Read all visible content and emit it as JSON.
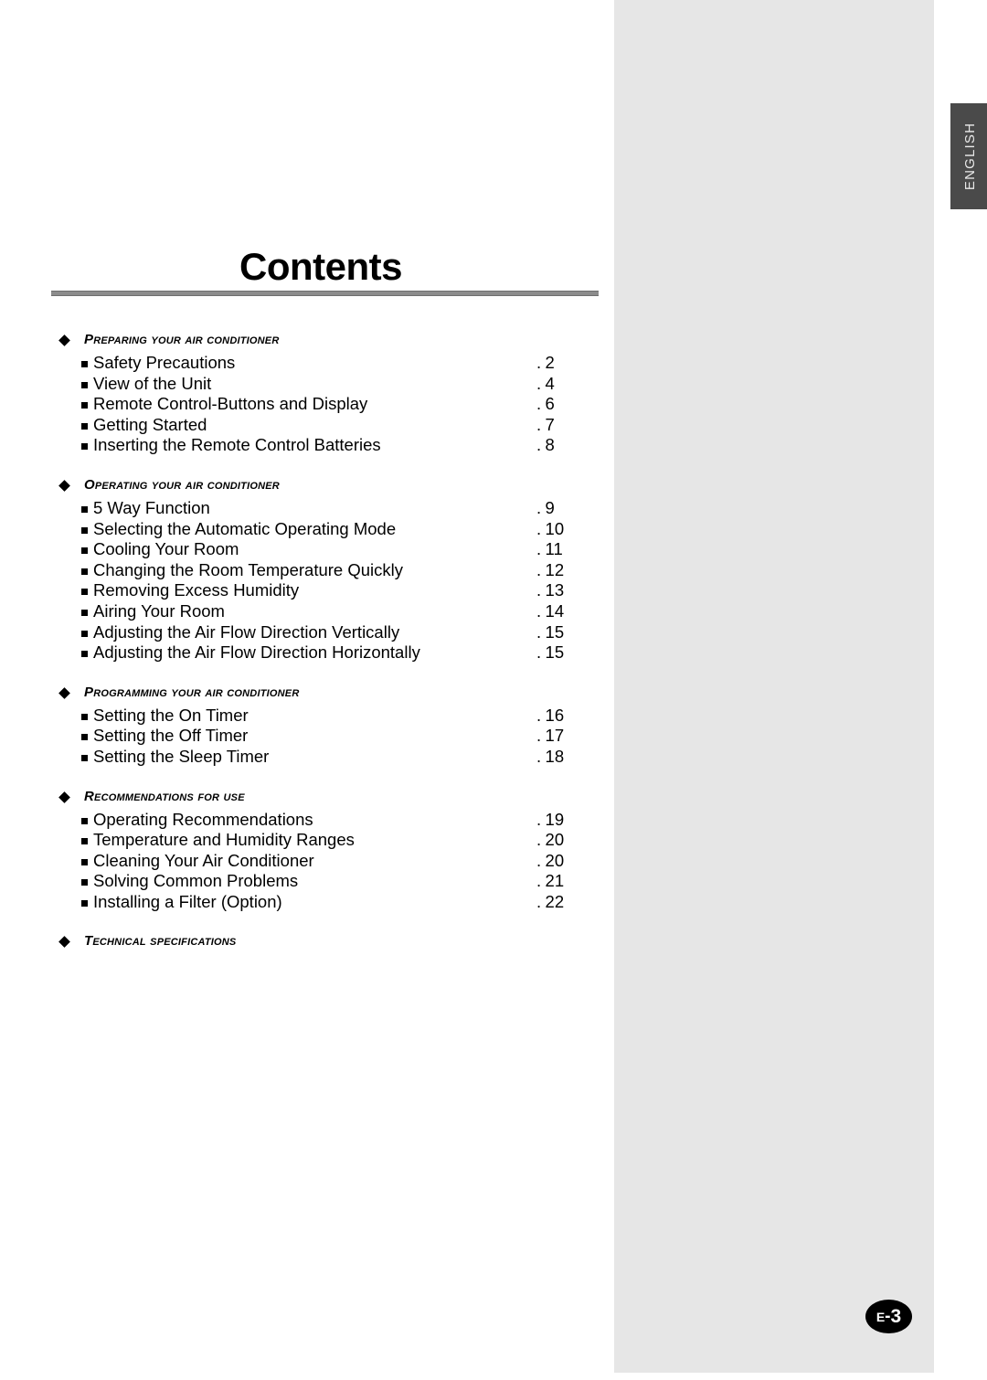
{
  "document": {
    "title": "Contents",
    "page_badge": {
      "prefix": "E",
      "separator": "-",
      "number": "3"
    },
    "language_tab": "ENGLISH"
  },
  "icons": {
    "diamond": "diamond-bullet-icon",
    "square": "square-bullet-icon"
  },
  "toc": {
    "sections": [
      {
        "heading": "Preparing your air conditioner",
        "entries": [
          {
            "title": "Safety Precautions",
            "page": "2"
          },
          {
            "title": "View of the Unit",
            "page": "4"
          },
          {
            "title": "Remote Control-Buttons and Display",
            "page": "6"
          },
          {
            "title": "Getting Started",
            "page": "7"
          },
          {
            "title": "Inserting the Remote Control Batteries",
            "page": "8"
          }
        ]
      },
      {
        "heading": "Operating your air conditioner",
        "entries": [
          {
            "title": "5 Way Function",
            "page": "9"
          },
          {
            "title": "Selecting the Automatic Operating Mode",
            "page": "10"
          },
          {
            "title": "Cooling Your Room",
            "page": "11"
          },
          {
            "title": "Changing the Room Temperature Quickly",
            "page": "12"
          },
          {
            "title": "Removing Excess Humidity",
            "page": "13"
          },
          {
            "title": "Airing Your Room",
            "page": "14"
          },
          {
            "title": "Adjusting the Air Flow Direction Vertically",
            "page": "15"
          },
          {
            "title": "Adjusting the Air Flow Direction Horizontally",
            "page": "15"
          }
        ]
      },
      {
        "heading": "Programming your air conditioner",
        "entries": [
          {
            "title": "Setting the On Timer",
            "page": "16"
          },
          {
            "title": "Setting the Off Timer",
            "page": "17"
          },
          {
            "title": "Setting the Sleep Timer",
            "page": "18"
          }
        ]
      },
      {
        "heading": "Recommendations for use",
        "entries": [
          {
            "title": "Operating Recommendations",
            "page": "19"
          },
          {
            "title": "Temperature and Humidity Ranges",
            "page": "20"
          },
          {
            "title": "Cleaning Your Air Conditioner",
            "page": "20"
          },
          {
            "title": "Solving Common Problems",
            "page": "21"
          },
          {
            "title": "Installing a Filter (Option)",
            "page": "22"
          }
        ]
      },
      {
        "heading": "Technical specifications",
        "entries": []
      }
    ]
  }
}
